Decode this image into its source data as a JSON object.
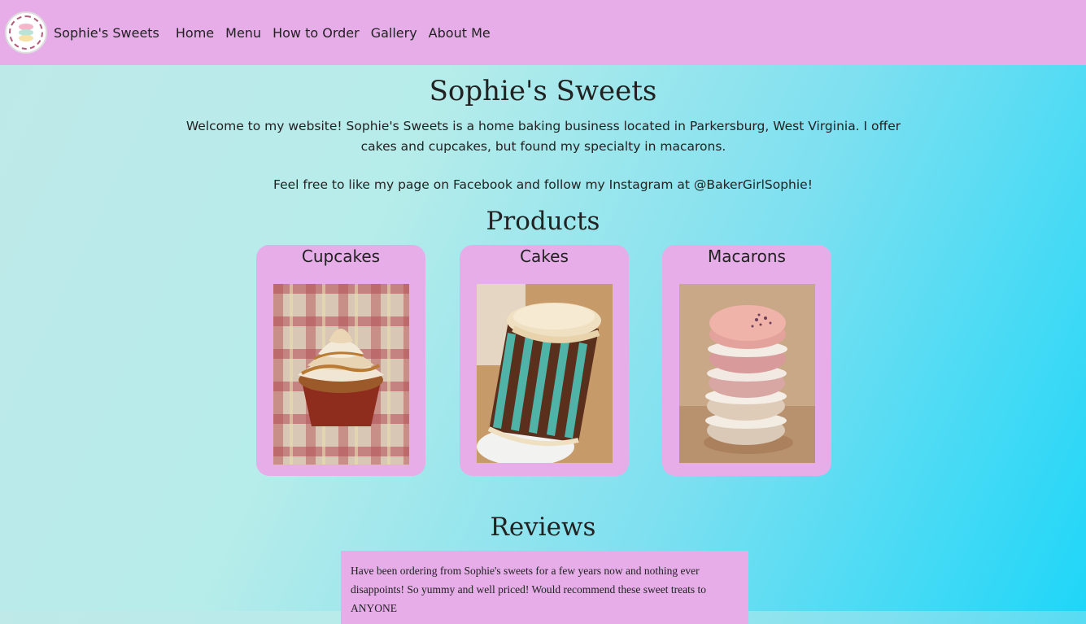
{
  "nav": {
    "brand": "Sophie's Sweets",
    "links": [
      "Home",
      "Menu",
      "How to Order",
      "Gallery",
      "About Me"
    ],
    "logo_icon": "sophies-sweets-logo"
  },
  "hero": {
    "title": "Sophie's Sweets",
    "intro": "Welcome to my website! Sophie's Sweets is a home baking business located in Parkersburg, West Virginia. I offer cakes and cupcakes, but found my specialty in macarons.",
    "follow": "Feel free to like my page on Facebook and follow my Instagram at @BakerGirlSophie!"
  },
  "products": {
    "heading": "Products",
    "items": [
      {
        "title": "Cupcakes"
      },
      {
        "title": "Cakes"
      },
      {
        "title": "Macarons"
      }
    ]
  },
  "reviews": {
    "heading": "Reviews",
    "items": [
      {
        "text": "Have been ordering from Sophie's sweets for a few years now and nothing ever disappoints! So yummy and well priced! Would recommend these sweet treats to ANYONE"
      }
    ]
  },
  "colors": {
    "nav_background": "#e6ade8",
    "card_background": "#e6ade8",
    "gradient_start": "#bfe9e9",
    "gradient_end": "#1fd6f8"
  }
}
